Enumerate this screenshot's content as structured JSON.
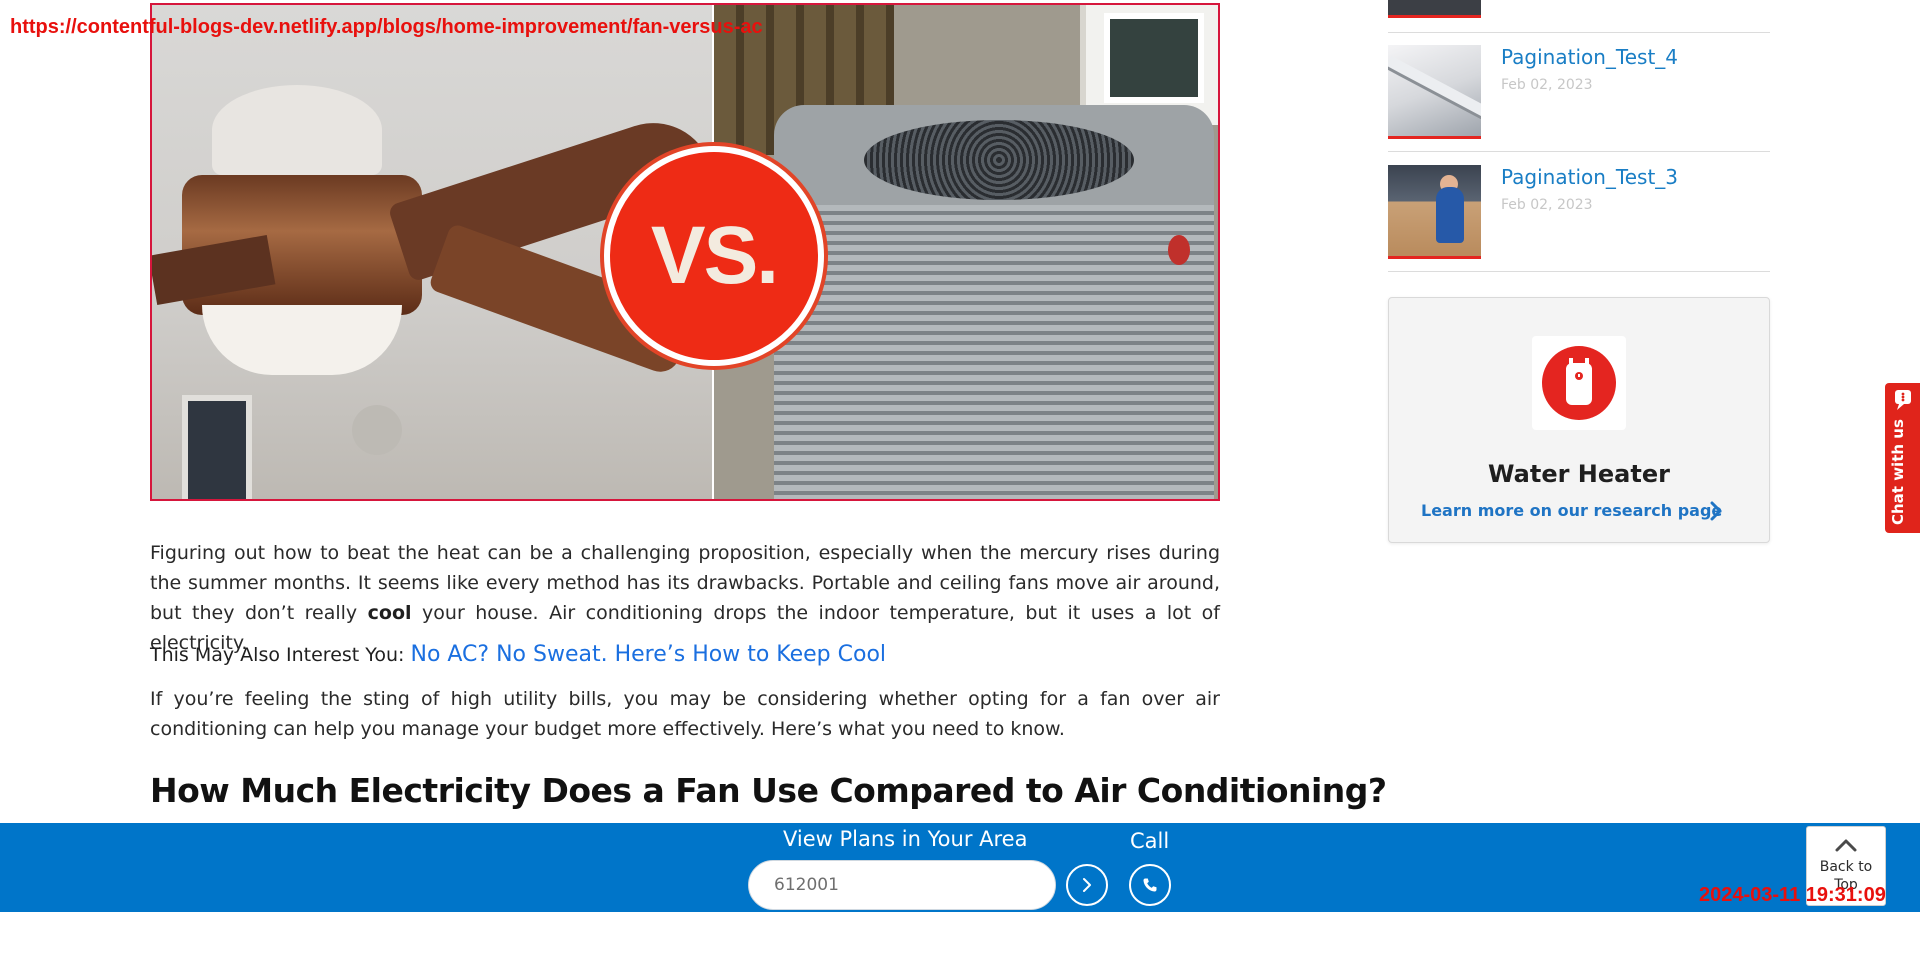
{
  "browser": {
    "url": "https://contentful-blogs-dev.netlify.app/blogs/home-improvement/fan-versus-ac",
    "timestamp": "2024-03-11 19:31:09"
  },
  "hero": {
    "badge_text": "VS."
  },
  "article": {
    "para1_a": "Figuring out how to beat the heat can be a challenging proposition, especially when the mercury rises during the summer months. It seems like every method has its drawbacks. Portable and ceiling fans move air around, but they don’t really ",
    "para1_bold": "cool",
    "para1_b": " your house. Air conditioning drops the indoor temperature, but it uses a lot of electricity.",
    "interest_label": "This May Also Interest You: ",
    "interest_link": "No AC? No Sweat. Here’s How to Keep Cool",
    "para2": "If you’re feeling the sting of high utility bills, you may be considering whether opting for a fan over air conditioning can help you manage your budget more effectively. Here’s what you need to know.",
    "heading": "How Much Electricity Does a Fan Use Compared to Air Conditioning?"
  },
  "sidebar": {
    "posts": [
      {
        "title": "Pagination_Test_4",
        "date": "Feb 02, 2023"
      },
      {
        "title": "Pagination_Test_3",
        "date": "Feb 02, 2023"
      }
    ],
    "card": {
      "title": "Water Heater",
      "link": "Learn more on our research page",
      "icon": "water-heater-icon",
      "accent": "#e42520"
    }
  },
  "chat": {
    "label": "Chat with us"
  },
  "bottom_bar": {
    "plans_label": "View Plans in Your Area",
    "zip_value": "612001",
    "call_label": "Call",
    "bar_color": "#0075c9"
  },
  "back_to_top": {
    "label": "Back to Top"
  }
}
